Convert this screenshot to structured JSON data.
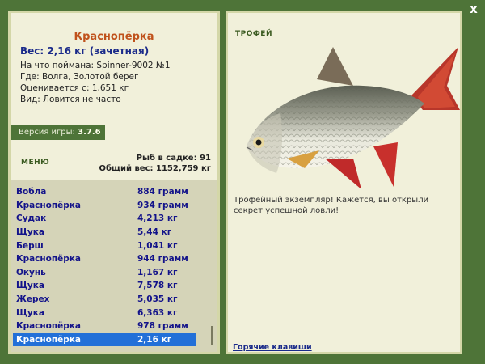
{
  "close_label": "x",
  "fish": {
    "title": "Краснопёрка",
    "weight_line": "Вес: 2,16 кг (зачетная)",
    "info": [
      "На что поймана: Spinner-9002 №1",
      "Где: Волга, Золотой берег",
      "Оценивается с: 1,651 кг",
      "Вид: Ловится не часто"
    ]
  },
  "version": {
    "label": "Версия игры:",
    "value": "3.7.6"
  },
  "menu_label": "МЕНЮ",
  "stats": {
    "count_line": "Рыб в садке: 91",
    "total_line": "Общий вес: 1152,759 кг"
  },
  "catch_list": [
    {
      "name": "Вобла",
      "weight": "884 грамм"
    },
    {
      "name": "Краснопёрка",
      "weight": "934 грамм"
    },
    {
      "name": "Судак",
      "weight": "4,213 кг"
    },
    {
      "name": "Щука",
      "weight": "5,44 кг"
    },
    {
      "name": "Берш",
      "weight": "1,041 кг"
    },
    {
      "name": "Краснопёрка",
      "weight": "944 грамм"
    },
    {
      "name": "Окунь",
      "weight": "1,167 кг"
    },
    {
      "name": "Щука",
      "weight": "7,578 кг"
    },
    {
      "name": "Жерех",
      "weight": "5,035 кг"
    },
    {
      "name": "Щука",
      "weight": "6,363 кг"
    },
    {
      "name": "Краснопёрка",
      "weight": "978 грамм"
    },
    {
      "name": "Краснопёрка",
      "weight": "2,16 кг"
    }
  ],
  "selected_index": 11,
  "trophy": {
    "label": "ТРОФЕЙ",
    "text": "Трофейный экземпляр! Кажется, вы открыли секрет успешной ловли!"
  },
  "hotkeys_label": "Горячие клавиши",
  "colors": {
    "background": "#4e7438",
    "panel": "#f1f0da",
    "list": "#d5d4b8",
    "selected": "#2270d8",
    "title": "#c0521c"
  }
}
